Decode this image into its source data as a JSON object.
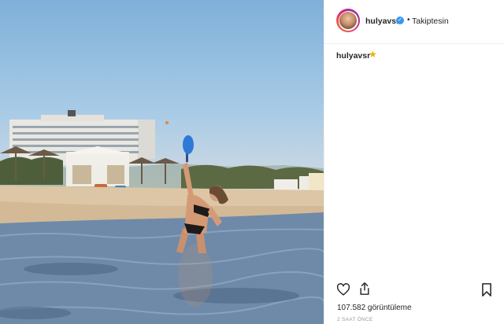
{
  "post": {
    "username": "hulyavsr",
    "follow_state": "Takiptesin",
    "separator": "•",
    "caption_user": "hulyavsr",
    "caption_emoji": "★",
    "views": "107.582 görüntüleme",
    "time_ago": "2 SAAT ÖNCE"
  },
  "icons": {
    "verified": "verified-badge-icon",
    "like": "heart-icon",
    "share": "share-icon",
    "save": "bookmark-icon"
  },
  "colors": {
    "verified_blue": "#3897f0",
    "text": "#262626",
    "muted": "#999999",
    "star": "#e8b400"
  }
}
